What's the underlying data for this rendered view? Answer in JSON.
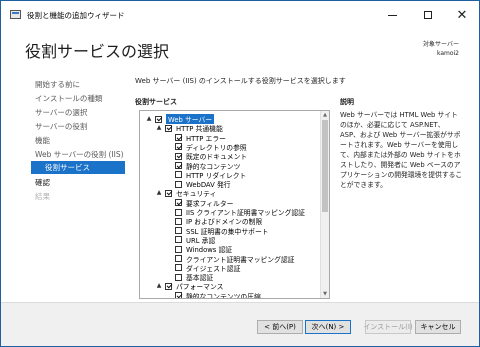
{
  "window": {
    "title": "役割と機能の追加ウィザード",
    "minimize_icon": "minimize-icon",
    "maximize_icon": "maximize-icon",
    "close_icon": "close-icon"
  },
  "header": {
    "page_title": "役割サービスの選択",
    "server_label": "対象サーバー",
    "server_name": "kamoi2"
  },
  "sidebar": {
    "steps": [
      {
        "label": "開始する前に",
        "state": "normal"
      },
      {
        "label": "インストールの種類",
        "state": "normal"
      },
      {
        "label": "サーバーの選択",
        "state": "normal"
      },
      {
        "label": "サーバーの役割",
        "state": "normal"
      },
      {
        "label": "機能",
        "state": "normal"
      },
      {
        "label": "Web サーバーの役割 (IIS)",
        "state": "normal"
      },
      {
        "label": "役割サービス",
        "state": "current"
      },
      {
        "label": "確認",
        "state": "active"
      },
      {
        "label": "結果",
        "state": "disabled"
      }
    ]
  },
  "content": {
    "intro": "Web サーバー (IIS) のインストールする役割サービスを選択します",
    "roles_heading": "役割サービス",
    "description_heading": "説明",
    "description": "Web サーバーでは HTML Web サイトのほか、必要に応じて ASP.NET、ASP、および Web サーバー拡張がサポートされます。Web サーバーを使用して、内部または外部の Web サイトをホストしたり、開発者に Web ベースのアプリケーションの開発環境を提供することができます。"
  },
  "tree": [
    {
      "label": "Web サーバー",
      "level": 0,
      "checked": true,
      "expander": "▲",
      "selected": true
    },
    {
      "label": "HTTP 共通機能",
      "level": 1,
      "checked": true,
      "expander": "▲"
    },
    {
      "label": "HTTP エラー",
      "level": 2,
      "checked": true
    },
    {
      "label": "ディレクトリの参照",
      "level": 2,
      "checked": true
    },
    {
      "label": "既定のドキュメント",
      "level": 2,
      "checked": true
    },
    {
      "label": "静的なコンテンツ",
      "level": 2,
      "checked": true
    },
    {
      "label": "HTTP リダイレクト",
      "level": 2,
      "checked": false
    },
    {
      "label": "WebDAV 発行",
      "level": 2,
      "checked": false
    },
    {
      "label": "セキュリティ",
      "level": 1,
      "checked": true,
      "expander": "▲"
    },
    {
      "label": "要求フィルター",
      "level": 2,
      "checked": true
    },
    {
      "label": "IIS クライアント証明書マッピング認証",
      "level": 2,
      "checked": false
    },
    {
      "label": "IP およびドメインの制限",
      "level": 2,
      "checked": false
    },
    {
      "label": "SSL 証明書の集中サポート",
      "level": 2,
      "checked": false
    },
    {
      "label": "URL 承認",
      "level": 2,
      "checked": false
    },
    {
      "label": "Windows 認証",
      "level": 2,
      "checked": false
    },
    {
      "label": "クライアント証明書マッピング認証",
      "level": 2,
      "checked": false
    },
    {
      "label": "ダイジェスト認証",
      "level": 2,
      "checked": false
    },
    {
      "label": "基本認証",
      "level": 2,
      "checked": false
    },
    {
      "label": "パフォーマンス",
      "level": 1,
      "checked": true,
      "expander": "▲"
    },
    {
      "label": "静的なコンテンツの圧縮",
      "level": 2,
      "checked": true
    }
  ],
  "buttons": {
    "prev": "< 前へ(P)",
    "next": "次へ(N) >",
    "install": "インストール(I)",
    "cancel": "キャンセル"
  },
  "colors": {
    "accent": "#1a73c9"
  }
}
